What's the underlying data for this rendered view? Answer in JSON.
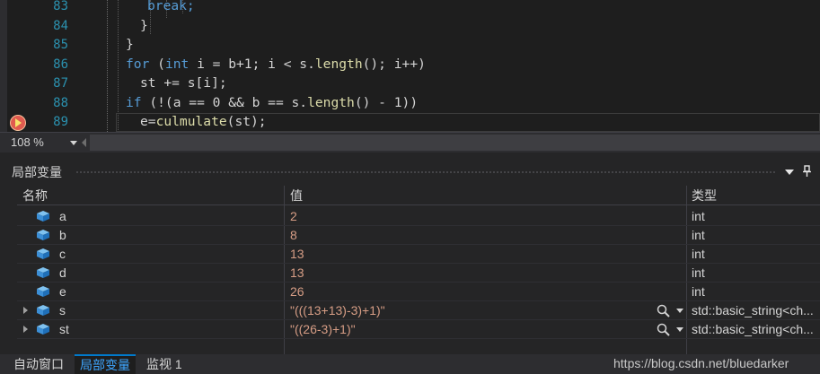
{
  "editor": {
    "lines": [
      {
        "no": "83",
        "tokens": [
          {
            "t": "break;",
            "c": "kw"
          }
        ],
        "indent": 11
      },
      {
        "no": "84",
        "tokens": [
          {
            "t": "}",
            "c": "p"
          }
        ],
        "indent": 9
      },
      {
        "no": "85",
        "tokens": [
          {
            "t": "}",
            "c": "p"
          }
        ],
        "indent": 5
      },
      {
        "no": "86",
        "tokens": [
          {
            "t": "for",
            "c": "kw"
          },
          {
            "t": " (",
            "c": "p"
          },
          {
            "t": "int",
            "c": "kw"
          },
          {
            "t": " i = b+1; i < s.",
            "c": "p"
          },
          {
            "t": "length",
            "c": "fn"
          },
          {
            "t": "(); i++)",
            "c": "p"
          }
        ],
        "indent": 5
      },
      {
        "no": "87",
        "tokens": [
          {
            "t": "st += s[i];",
            "c": "p"
          }
        ],
        "indent": 9
      },
      {
        "no": "88",
        "tokens": [
          {
            "t": "if",
            "c": "kw"
          },
          {
            "t": " (!(a == 0 && b == s.",
            "c": "p"
          },
          {
            "t": "length",
            "c": "fn"
          },
          {
            "t": "() - 1))",
            "c": "p"
          }
        ],
        "indent": 5
      },
      {
        "no": "89",
        "tokens": [
          {
            "t": "e=",
            "c": "p"
          },
          {
            "t": "culmulate",
            "c": "fn"
          },
          {
            "t": "(st);",
            "c": "p"
          }
        ],
        "indent": 9
      }
    ]
  },
  "zoom": {
    "value": "108 %"
  },
  "locals": {
    "title": "局部变量",
    "columns": {
      "name": "名称",
      "value": "值",
      "type": "类型"
    },
    "rows": [
      {
        "name": "a",
        "value": "2",
        "type": "int",
        "expandable": false
      },
      {
        "name": "b",
        "value": "8",
        "type": "int",
        "expandable": false
      },
      {
        "name": "c",
        "value": "13",
        "type": "int",
        "expandable": false
      },
      {
        "name": "d",
        "value": "13",
        "type": "int",
        "expandable": false
      },
      {
        "name": "e",
        "value": "26",
        "type": "int",
        "expandable": false
      },
      {
        "name": "s",
        "value": "\"(((13+13)-3)+1)\"",
        "type": "std::basic_string<ch...",
        "expandable": true
      },
      {
        "name": "st",
        "value": "\"((26-3)+1)\"",
        "type": "std::basic_string<ch...",
        "expandable": true
      }
    ]
  },
  "tabs": [
    {
      "label": "自动窗口",
      "active": false
    },
    {
      "label": "局部变量",
      "active": true
    },
    {
      "label": "监视 1",
      "active": false
    }
  ],
  "watermark": "https://blog.csdn.net/bluedarker",
  "colors": {
    "keyword": "#569cd6",
    "function": "#dcdcaa",
    "value": "#d69d85",
    "line_number": "#2b91af",
    "active_tab": "#3ea6ff"
  }
}
